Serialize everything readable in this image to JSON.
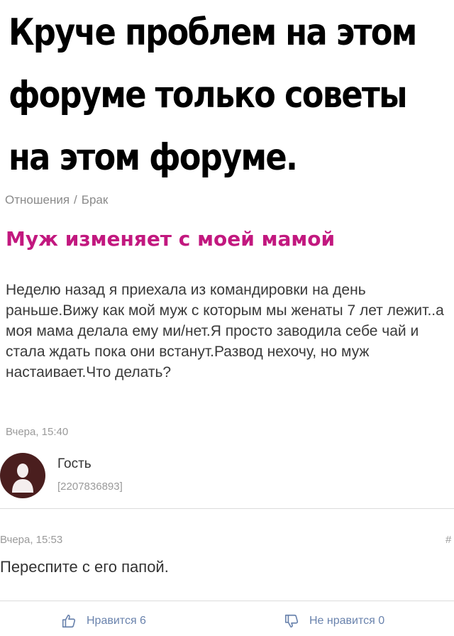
{
  "meme": {
    "lines": [
      "Круче проблем на этом",
      "форуме только советы",
      "на этом форуме."
    ]
  },
  "breadcrumb": {
    "section": "Отношения",
    "separator": "/",
    "subsection": "Брак"
  },
  "topic": {
    "title": "Муж изменяет с моей мамой",
    "body": "Неделю назад я приехала из командировки на день раньше.Вижу как мой муж с которым мы женаты 7 лет лежит..а моя мама делала ему ми/нет.Я просто заводила себе чай и стала ждать пока они встанут.Развод нехочу, но муж настаивает.Что делать?",
    "time": "Вчера, 15:40",
    "author": {
      "name": "Гость",
      "id": "[2207836893]",
      "avatar_icon": "user-silhouette-icon"
    }
  },
  "reply": {
    "time": "Вчера, 15:53",
    "number_prefix": "#",
    "text": "Переспите с его папой."
  },
  "votes": {
    "like_label": "Нравится 6",
    "dislike_label": "Не нравится 0",
    "like_icon": "thumbs-up-icon",
    "dislike_icon": "thumbs-down-icon",
    "color": "#6a83ad"
  },
  "colors": {
    "title": "#c2187f",
    "avatar_bg": "#4a1e1e"
  }
}
